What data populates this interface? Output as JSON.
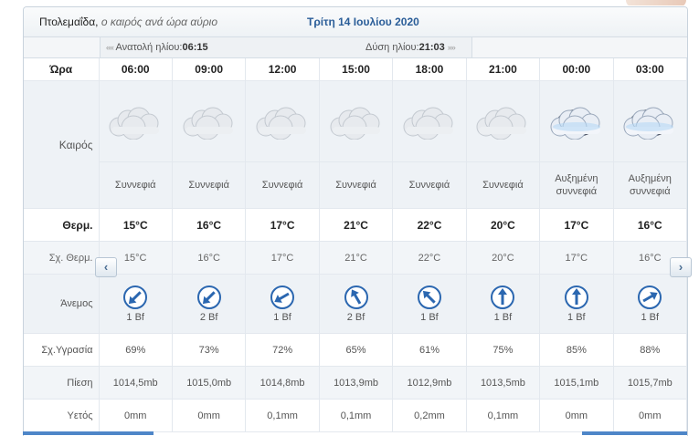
{
  "page": {
    "location": "Πτολεμαΐδα,",
    "location_sub": "ο καιρός ανά ώρα αύριο",
    "date": "Τρίτη 14 Ιουλίου 2020"
  },
  "sun": {
    "sunrise_label": "Ανατολή ηλίου:",
    "sunrise_time": "06:15",
    "sunset_label": "Δύση ηλίου:",
    "sunset_time": "21:03",
    "arrow_left": "«‹‹",
    "arrow_right": "››»"
  },
  "labels": {
    "hour": "Ώρα",
    "weather": "Καιρός",
    "temp": "Θερμ.",
    "feels": "Σχ. Θερμ.",
    "wind": "Άνεμος",
    "humidity": "Σχ.Υγρασία",
    "pressure": "Πίεση",
    "rain": "Υετός"
  },
  "nav": {
    "prev": "‹",
    "next": "›"
  },
  "forecast": [
    {
      "hour": "06:00",
      "icon": "cloudy-icon",
      "cond1": "Συννεφιά",
      "cond2": "",
      "temp": "15°C",
      "feels": "15°C",
      "wind_dir": 225,
      "wind": "1 Bf",
      "humidity": "69%",
      "pressure": "1014,5mb",
      "rain": "0mm"
    },
    {
      "hour": "09:00",
      "icon": "cloudy-icon",
      "cond1": "Συννεφιά",
      "cond2": "",
      "temp": "16°C",
      "feels": "16°C",
      "wind_dir": 225,
      "wind": "2 Bf",
      "humidity": "73%",
      "pressure": "1015,0mb",
      "rain": "0mm"
    },
    {
      "hour": "12:00",
      "icon": "cloudy-icon",
      "cond1": "Συννεφιά",
      "cond2": "",
      "temp": "17°C",
      "feels": "17°C",
      "wind_dir": 240,
      "wind": "1 Bf",
      "humidity": "72%",
      "pressure": "1014,8mb",
      "rain": "0,1mm"
    },
    {
      "hour": "15:00",
      "icon": "cloudy-icon",
      "cond1": "Συννεφιά",
      "cond2": "",
      "temp": "21°C",
      "feels": "21°C",
      "wind_dir": 330,
      "wind": "2 Bf",
      "humidity": "65%",
      "pressure": "1013,9mb",
      "rain": "0,1mm"
    },
    {
      "hour": "18:00",
      "icon": "cloudy-icon",
      "cond1": "Συννεφιά",
      "cond2": "",
      "temp": "22°C",
      "feels": "22°C",
      "wind_dir": 315,
      "wind": "1 Bf",
      "humidity": "61%",
      "pressure": "1012,9mb",
      "rain": "0,2mm"
    },
    {
      "hour": "21:00",
      "icon": "cloudy-icon",
      "cond1": "Συννεφιά",
      "cond2": "",
      "temp": "20°C",
      "feels": "20°C",
      "wind_dir": 0,
      "wind": "1 Bf",
      "humidity": "75%",
      "pressure": "1013,5mb",
      "rain": "0,1mm"
    },
    {
      "hour": "00:00",
      "icon": "night-cloudy-icon",
      "cond1": "Αυξημένη",
      "cond2": "συννεφιά",
      "temp": "17°C",
      "feels": "17°C",
      "wind_dir": 0,
      "wind": "1 Bf",
      "humidity": "85%",
      "pressure": "1015,1mb",
      "rain": "0mm"
    },
    {
      "hour": "03:00",
      "icon": "night-cloudy-icon",
      "cond1": "Αυξημένη",
      "cond2": "συννεφιά",
      "temp": "16°C",
      "feels": "16°C",
      "wind_dir": 60,
      "wind": "1 Bf",
      "humidity": "88%",
      "pressure": "1015,7mb",
      "rain": "0mm"
    }
  ],
  "colors": {
    "accent": "#2a5d98",
    "wind_icon": "#2b67b0",
    "bar": "#4e86c8"
  }
}
